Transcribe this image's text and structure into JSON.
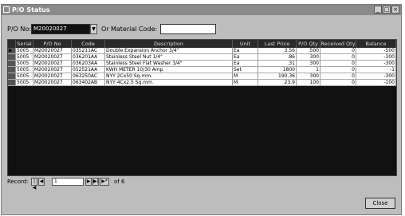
{
  "window": {
    "title": "P/O Status"
  },
  "filter": {
    "po_label": "P/O No:",
    "po_value": "M20020027",
    "or_label": "Or",
    "material_label": "Material Code:",
    "material_value": ""
  },
  "table": {
    "columns": [
      "",
      "Serial",
      "P/O No",
      "Code",
      "Description",
      "Unit",
      "Last Price",
      "P/O Qty",
      "Received Qty",
      "Balance"
    ],
    "rows": [
      {
        "selector": "▶",
        "serial": "5005",
        "po": "M20020027",
        "code": "035211AC",
        "desc": "Double Expansion Anchor 3/4\"",
        "unit": "Ea",
        "price": "3.56",
        "qty": "500",
        "received": "0",
        "balance": "-500"
      },
      {
        "selector": "",
        "serial": "5005",
        "po": "M20020027",
        "code": "036201AA",
        "desc": "Stainless Steel Nut 1/4\"",
        "unit": "Ea",
        "price": ".86",
        "qty": "300",
        "received": "0",
        "balance": "-300"
      },
      {
        "selector": "",
        "serial": "5005",
        "po": "M20020027",
        "code": "036203AA",
        "desc": "Stainless Steel Flat Washer 3/4\"",
        "unit": "Ea",
        "price": ".31",
        "qty": "300",
        "received": "0",
        "balance": "-300"
      },
      {
        "selector": "",
        "serial": "5005",
        "po": "M20020027",
        "code": "052521AA",
        "desc": "KWH METER 10/30 Amp",
        "unit": "Set",
        "price": "1800",
        "qty": "1",
        "received": "0",
        "balance": "-1"
      },
      {
        "selector": "",
        "serial": "5005",
        "po": "M20020027",
        "code": "063250AC",
        "desc": "NYY 2Cx50 Sq.mm.",
        "unit": "M",
        "price": "190.36",
        "qty": "300",
        "received": "0",
        "balance": "-300"
      },
      {
        "selector": "",
        "serial": "5005",
        "po": "M20020027",
        "code": "063402AB",
        "desc": "NYY 4Cx2.5 Sq.mm.",
        "unit": "M",
        "price": "23.9",
        "qty": "100",
        "received": "0",
        "balance": "-100"
      }
    ]
  },
  "nav": {
    "label": "Record:",
    "first": "|◀",
    "prev": "◀",
    "record": "1",
    "next": "▶",
    "last": "▶|",
    "new": "▶*",
    "of": "of 6"
  },
  "buttons": {
    "close": "Close"
  }
}
